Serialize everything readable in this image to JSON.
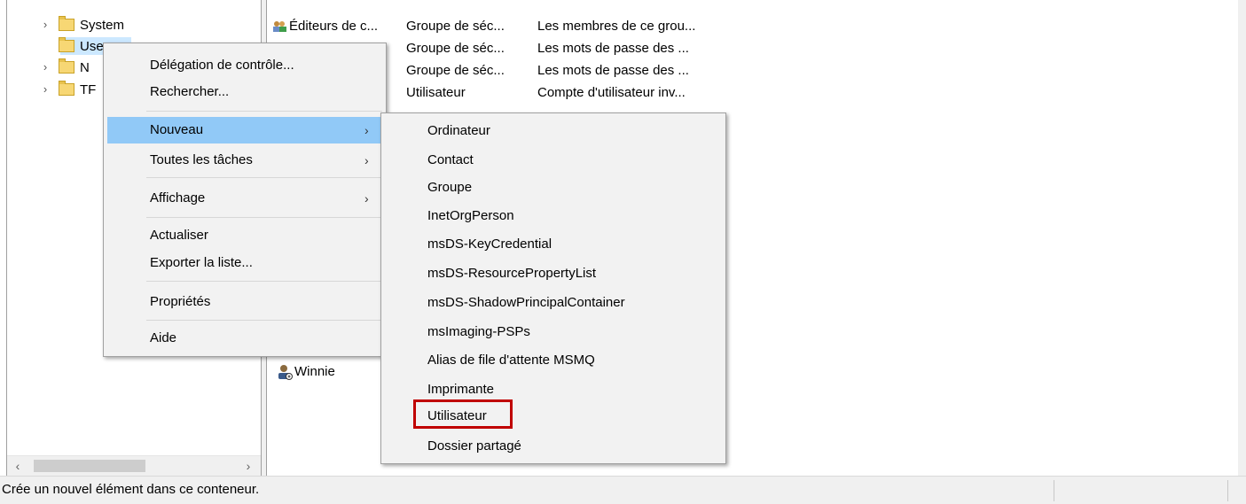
{
  "tree": {
    "items": [
      {
        "label": "System",
        "chevron": "›"
      },
      {
        "label": "Users",
        "chevron": ""
      },
      {
        "label": "N",
        "chevron": "›"
      },
      {
        "label": "TF",
        "chevron": "›"
      }
    ],
    "scroll_left": "‹",
    "scroll_right": "›"
  },
  "list": {
    "rows": [
      {
        "name": "Éditeurs de c...",
        "type": "Groupe de séc...",
        "description": "Les membres de ce grou...",
        "icon": "group-icon"
      },
      {
        "name": "",
        "type": "Groupe de séc...",
        "description": "Les mots de passe des ...",
        "icon": "group-icon"
      },
      {
        "name": "",
        "type": "Groupe de séc...",
        "description": "Les mots de passe des ...",
        "icon": "group-icon"
      },
      {
        "name": "",
        "type": "Utilisateur",
        "description": "Compte d'utilisateur inv...",
        "icon": "user-icon"
      }
    ],
    "winnie": "Winnie"
  },
  "context_menu": {
    "items": [
      {
        "label": "Délégation de contrôle...",
        "has_submenu": false
      },
      {
        "label": "Rechercher...",
        "has_submenu": false
      },
      {
        "label": "Nouveau",
        "has_submenu": true,
        "active": true
      },
      {
        "label": "Toutes les tâches",
        "has_submenu": true
      },
      {
        "label": "Affichage",
        "has_submenu": true
      },
      {
        "label": "Actualiser",
        "has_submenu": false
      },
      {
        "label": "Exporter la liste...",
        "has_submenu": false
      },
      {
        "label": "Propriétés",
        "has_submenu": false
      },
      {
        "label": "Aide",
        "has_submenu": false
      }
    ],
    "arrow": "›"
  },
  "submenu": {
    "items": [
      "Ordinateur",
      "Contact",
      "Groupe",
      "InetOrgPerson",
      "msDS-KeyCredential",
      "msDS-ResourcePropertyList",
      "msDS-ShadowPrincipalContainer",
      "msImaging-PSPs",
      "Alias de file d'attente MSMQ",
      "Imprimante",
      "Utilisateur",
      "Dossier partagé"
    ],
    "highlighted": "Utilisateur"
  },
  "status": {
    "text": "Crée un nouvel élément dans ce conteneur."
  },
  "colors": {
    "menu_active": "#91c9f7",
    "highlight_box": "#c00000",
    "selection": "#cce8ff"
  }
}
